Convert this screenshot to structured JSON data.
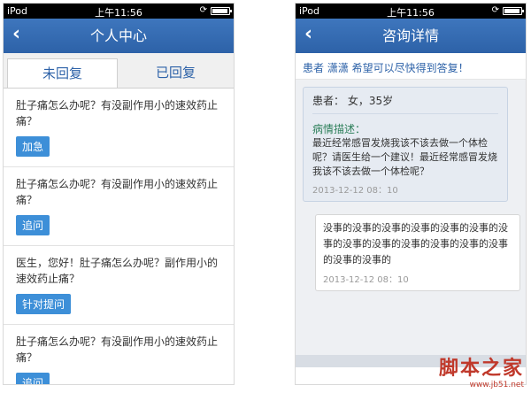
{
  "status_bar": {
    "carrier": "iPod",
    "time": "上午11:56",
    "lock_icon": "rotation-lock-icon",
    "battery_level": 0.9
  },
  "left_screen": {
    "nav": {
      "back_icon": "chevron-left-icon",
      "title": "个人中心"
    },
    "tabs": [
      {
        "label": "未回复"
      },
      {
        "label": "已回复"
      }
    ],
    "questions": [
      {
        "text": "肚子痛怎么办呢？有没副作用小的速效药止痛？",
        "button": "加急"
      },
      {
        "text": "肚子痛怎么办呢？有没副作用小的速效药止痛？",
        "button": "追问"
      },
      {
        "text": "医生，您好！肚子痛怎么办呢？副作用小的速效药止痛？",
        "button": "针对提问"
      },
      {
        "text": "肚子痛怎么办呢？有没副作用小的速效药止痛？",
        "button": "追问"
      }
    ]
  },
  "right_screen": {
    "nav": {
      "back_icon": "chevron-left-icon",
      "title": "咨询详情"
    },
    "notice": "患者 潇潇  希望可以尽快得到答复！",
    "patient_message": {
      "patient_info": "患者： 女，35岁",
      "desc_label": "病情描述：",
      "desc_text": "最近经常感冒发烧我该不该去做一个体检呢？请医生给一个建议！最近经常感冒发烧我该不该去做一个体检呢？",
      "timestamp": "2013-12-12   08：10"
    },
    "doctor_reply": {
      "text": "没事的没事的没事的没事的没事的没事的没事的没事的没事的没事的没事的没事的没事的没事的没事的",
      "timestamp": "2013-12-12   08：10"
    }
  },
  "watermark": {
    "main": "脚本之家",
    "sub": "www.jb51.net"
  },
  "colors": {
    "nav_blue": "#2d62a8",
    "button_blue": "#3d8fd8",
    "watermark_red": "#c0392b"
  }
}
